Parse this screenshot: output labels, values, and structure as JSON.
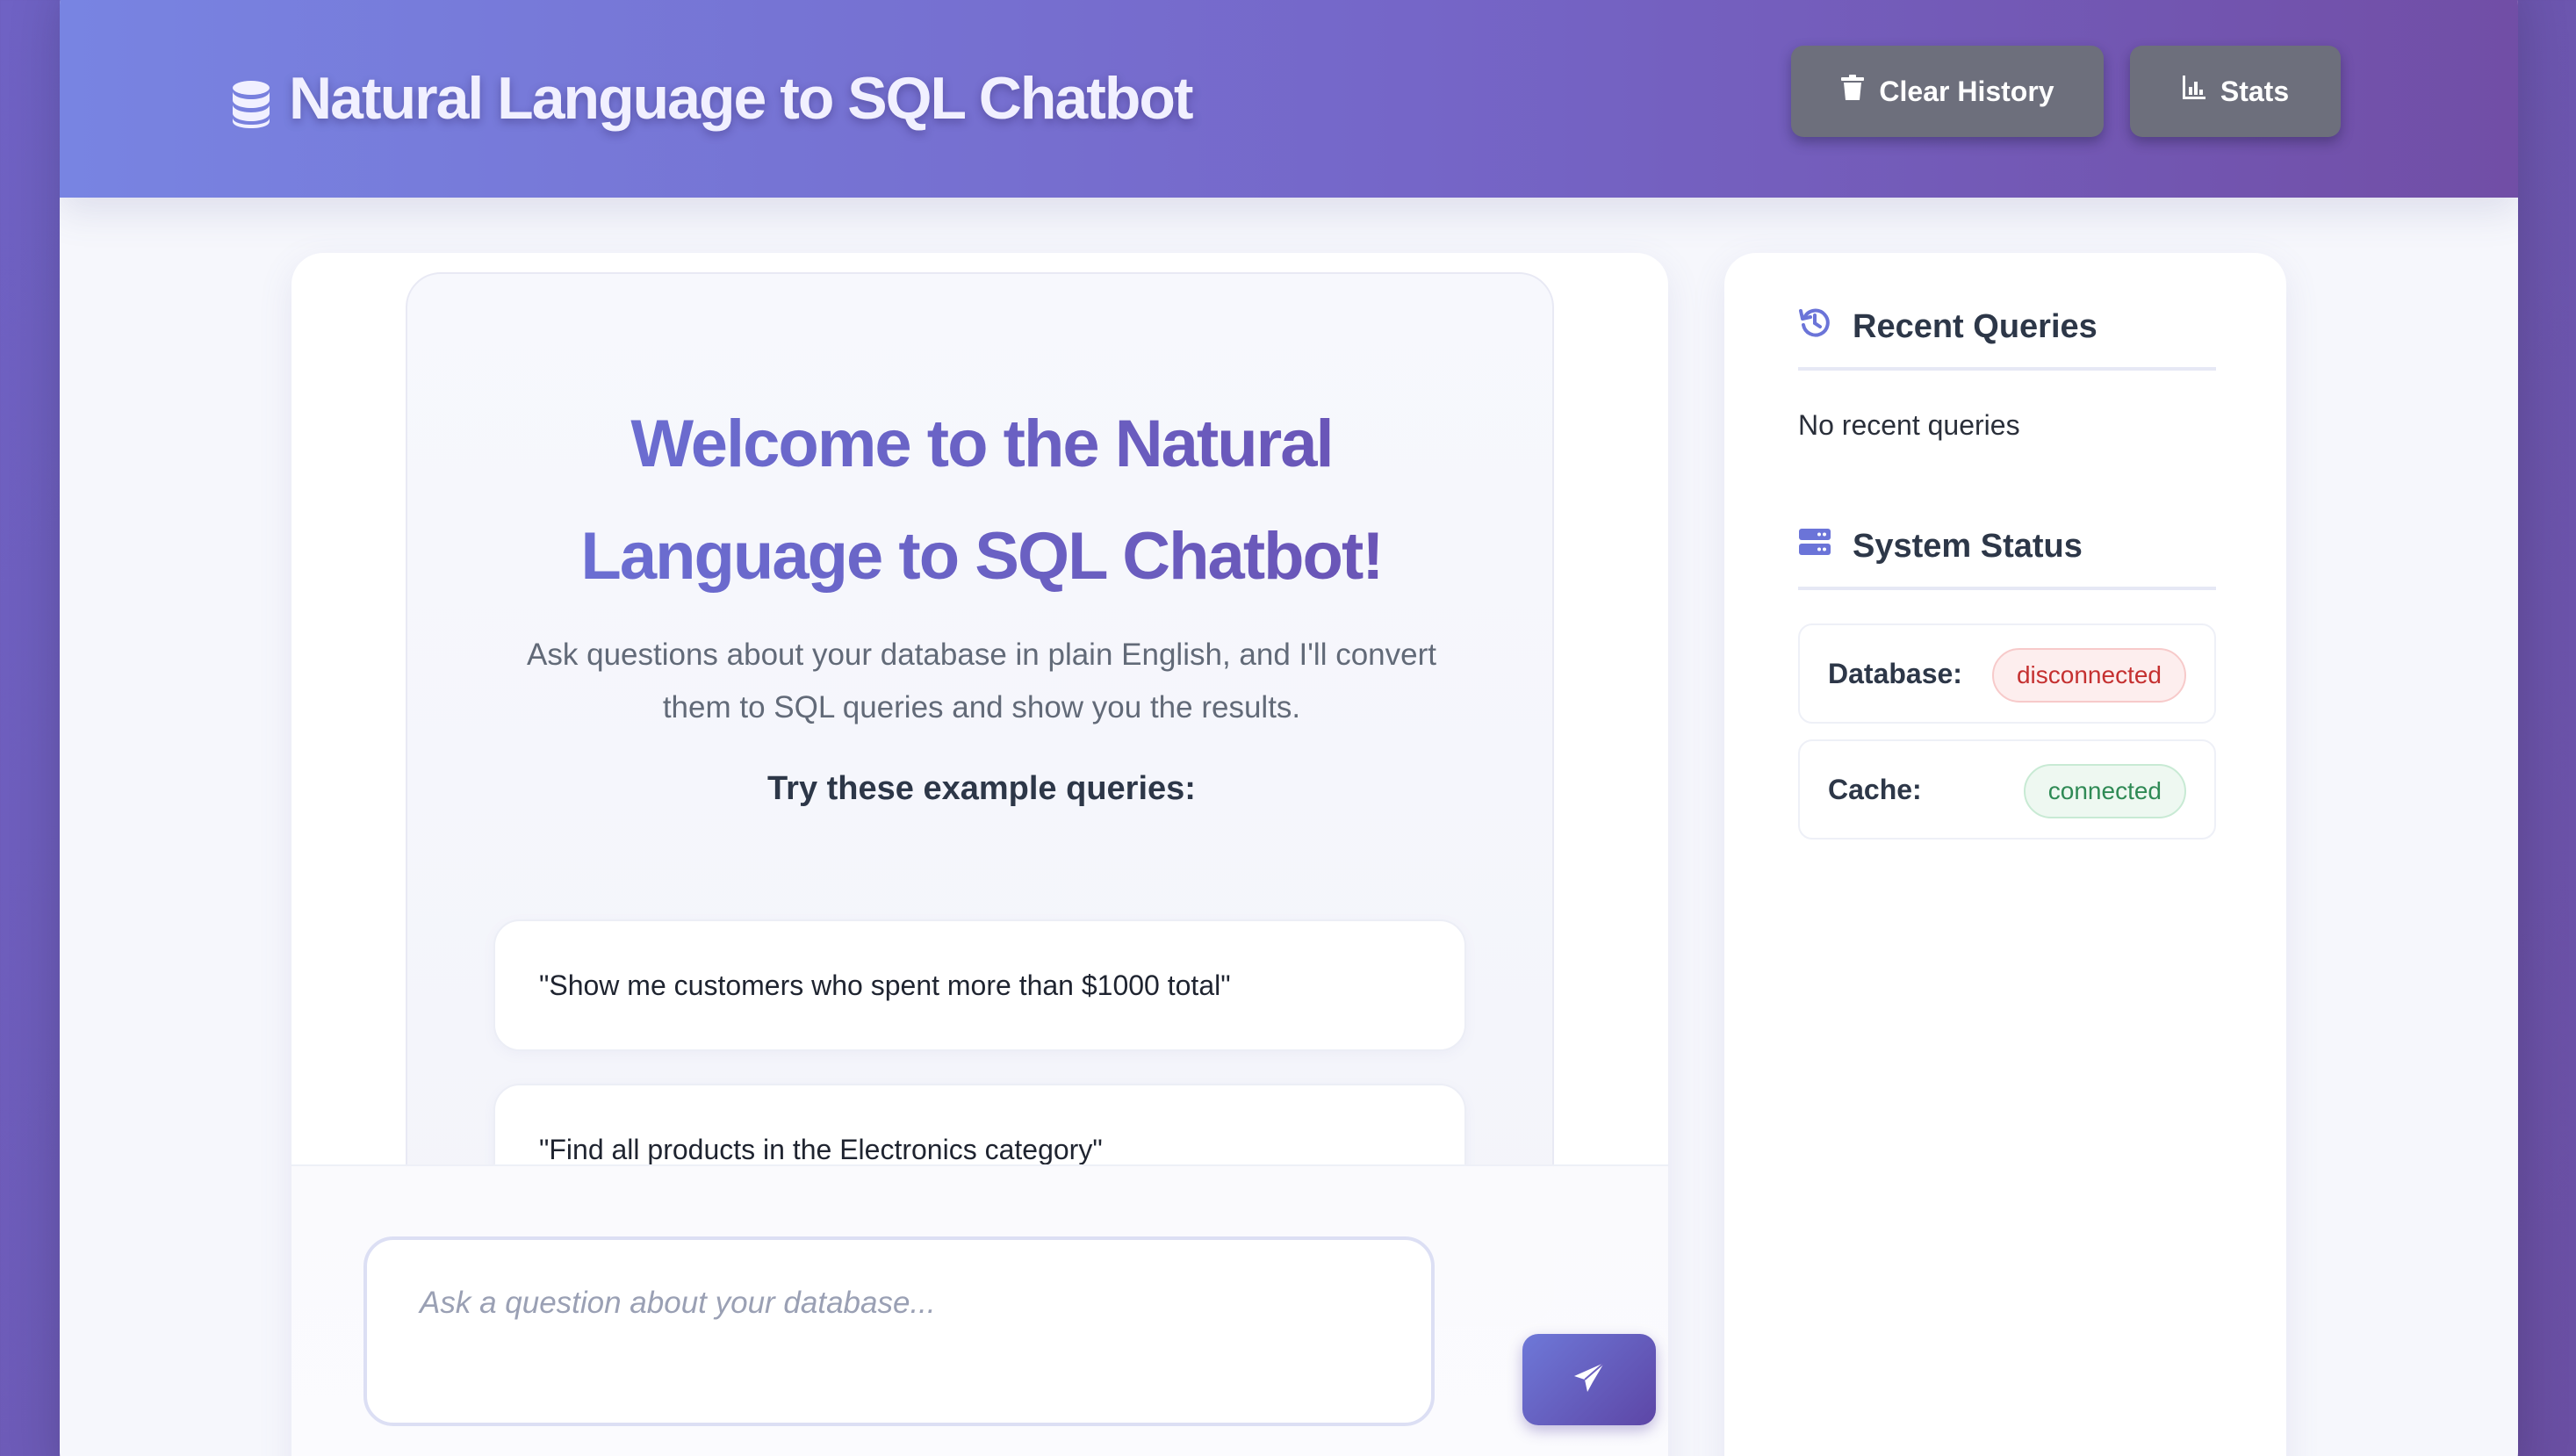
{
  "header": {
    "title": "Natural Language to SQL Chatbot",
    "clear_history_label": "Clear History",
    "stats_label": "Stats"
  },
  "welcome": {
    "title_line1": "Welcome to the Natural",
    "title_line2": "Language to SQL Chatbot!",
    "subtitle_line1": "Ask questions about your database in plain English, and I'll convert",
    "subtitle_line2": "them to SQL queries and show you the results.",
    "examples_heading": "Try these example queries:",
    "examples": [
      "\"Show me customers who spent more than $1000 total\"",
      "\"Find all products in the Electronics category\""
    ]
  },
  "input": {
    "placeholder": "Ask a question about your database...",
    "value": ""
  },
  "sidebar": {
    "recent_heading": "Recent Queries",
    "no_recent": "No recent queries",
    "status_heading": "System Status",
    "status": [
      {
        "label": "Database:",
        "value": "disconnected",
        "state": "error"
      },
      {
        "label": "Cache:",
        "value": "connected",
        "state": "ok"
      }
    ]
  },
  "colors": {
    "accent": "#6b74d8",
    "accent_dark": "#6a4fb0",
    "error": "#c53030",
    "success": "#2f8a55"
  },
  "icons": {
    "title": "database-icon",
    "clear_history": "trash-icon",
    "stats": "bar-chart-icon",
    "send": "paper-plane-icon",
    "recent": "history-icon",
    "status": "server-icon"
  }
}
